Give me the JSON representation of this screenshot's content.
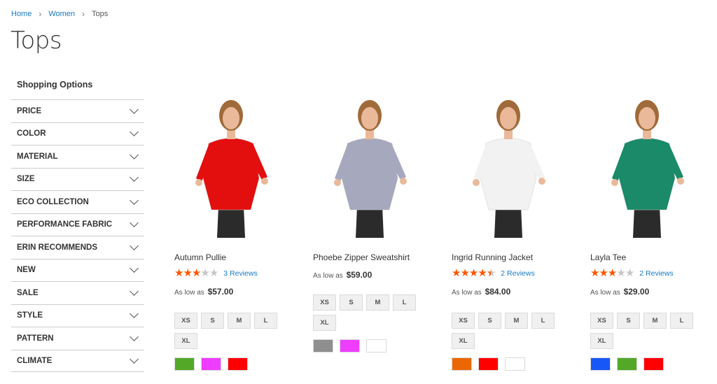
{
  "breadcrumb": {
    "home": "Home",
    "women": "Women",
    "current": "Tops"
  },
  "page_title": "Tops",
  "sidebar": {
    "title": "Shopping Options",
    "filters": [
      "PRICE",
      "COLOR",
      "MATERIAL",
      "SIZE",
      "ECO COLLECTION",
      "PERFORMANCE FABRIC",
      "ERIN RECOMMENDS",
      "NEW",
      "SALE",
      "STYLE",
      "PATTERN",
      "CLIMATE"
    ]
  },
  "products": [
    {
      "name": "Autumn Pullie",
      "rating_stars": 3,
      "reviews": "3  Reviews",
      "price_prefix": "As low as",
      "price": "$57.00",
      "garment_color": "#e30e0e",
      "sizes": [
        "XS",
        "S",
        "M",
        "L",
        "XL"
      ],
      "colors": [
        "#53a828",
        "#ef3dff",
        "#ff0000"
      ]
    },
    {
      "name": "Phoebe Zipper Sweatshirt",
      "rating_stars": 0,
      "reviews": "",
      "price_prefix": "As low as",
      "price": "$59.00",
      "garment_color": "#a6a8bd",
      "sizes": [
        "XS",
        "S",
        "M",
        "L",
        "XL"
      ],
      "colors": [
        "#8f8f8f",
        "#ef3dff",
        "#ffffff"
      ]
    },
    {
      "name": "Ingrid Running Jacket",
      "rating_stars": 4.5,
      "reviews": "2  Reviews",
      "price_prefix": "As low as",
      "price": "$84.00",
      "garment_color": "#f2f2f2",
      "sizes": [
        "XS",
        "S",
        "M",
        "L",
        "XL"
      ],
      "colors": [
        "#eb6703",
        "#ff0000",
        "#ffffff"
      ]
    },
    {
      "name": "Layla Tee",
      "rating_stars": 3,
      "reviews": "2  Reviews",
      "price_prefix": "As low as",
      "price": "$29.00",
      "garment_color": "#1a8a68",
      "sizes": [
        "XS",
        "S",
        "M",
        "L",
        "XL"
      ],
      "colors": [
        "#1857f7",
        "#53a828",
        "#ff0000"
      ]
    }
  ],
  "colors": {
    "link": "#1979c3",
    "star": "#ff5501",
    "star_empty": "#c7c7c7"
  }
}
